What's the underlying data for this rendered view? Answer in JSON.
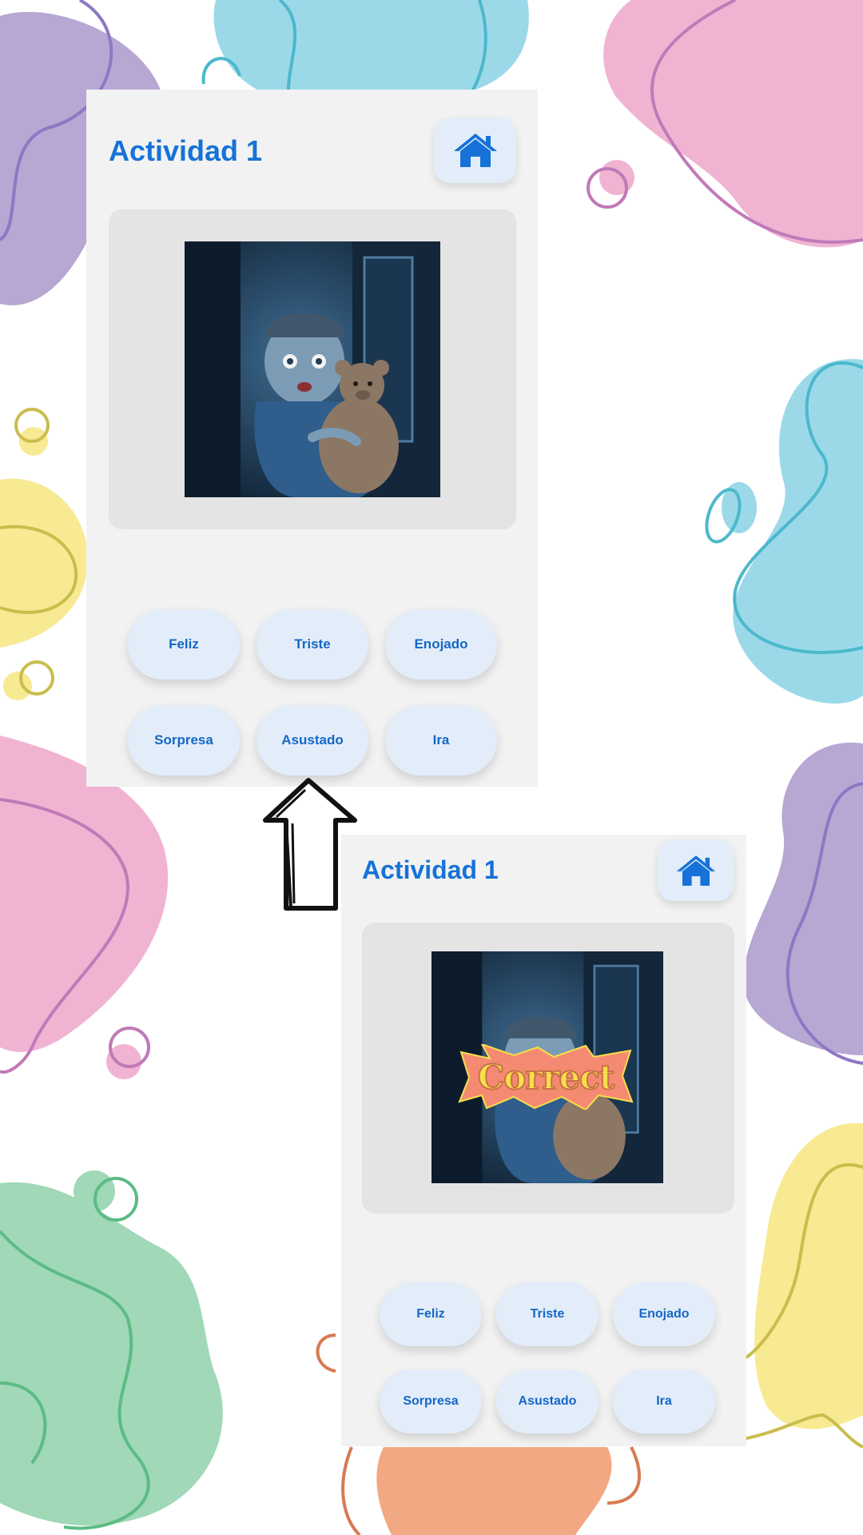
{
  "activity_title": "Actividad 1",
  "feedback_text": "Correct",
  "top_panel": {
    "title": "Actividad 1",
    "home_icon": "home-icon",
    "image_subject": "scared-child-with-teddy-bear",
    "options": [
      "Feliz",
      "Triste",
      "Enojado",
      "Sorpresa",
      "Asustado",
      "Ira"
    ]
  },
  "bottom_panel": {
    "title": "Actividad 1",
    "home_icon": "home-icon",
    "image_subject": "scared-child-with-teddy-bear",
    "feedback": "Correct",
    "options": [
      "Feliz",
      "Triste",
      "Enojado",
      "Sorpresa",
      "Asustado",
      "Ira"
    ]
  },
  "colors": {
    "accent": "#1672d8",
    "button_bg": "#e2edf9",
    "panel_bg": "#f2f2f2",
    "card_bg": "#e4e4e4",
    "feedback_bg": "#f58a72",
    "feedback_text": "#f7df4a"
  },
  "decorations": [
    "arrow-up-icon",
    "background-blobs"
  ]
}
